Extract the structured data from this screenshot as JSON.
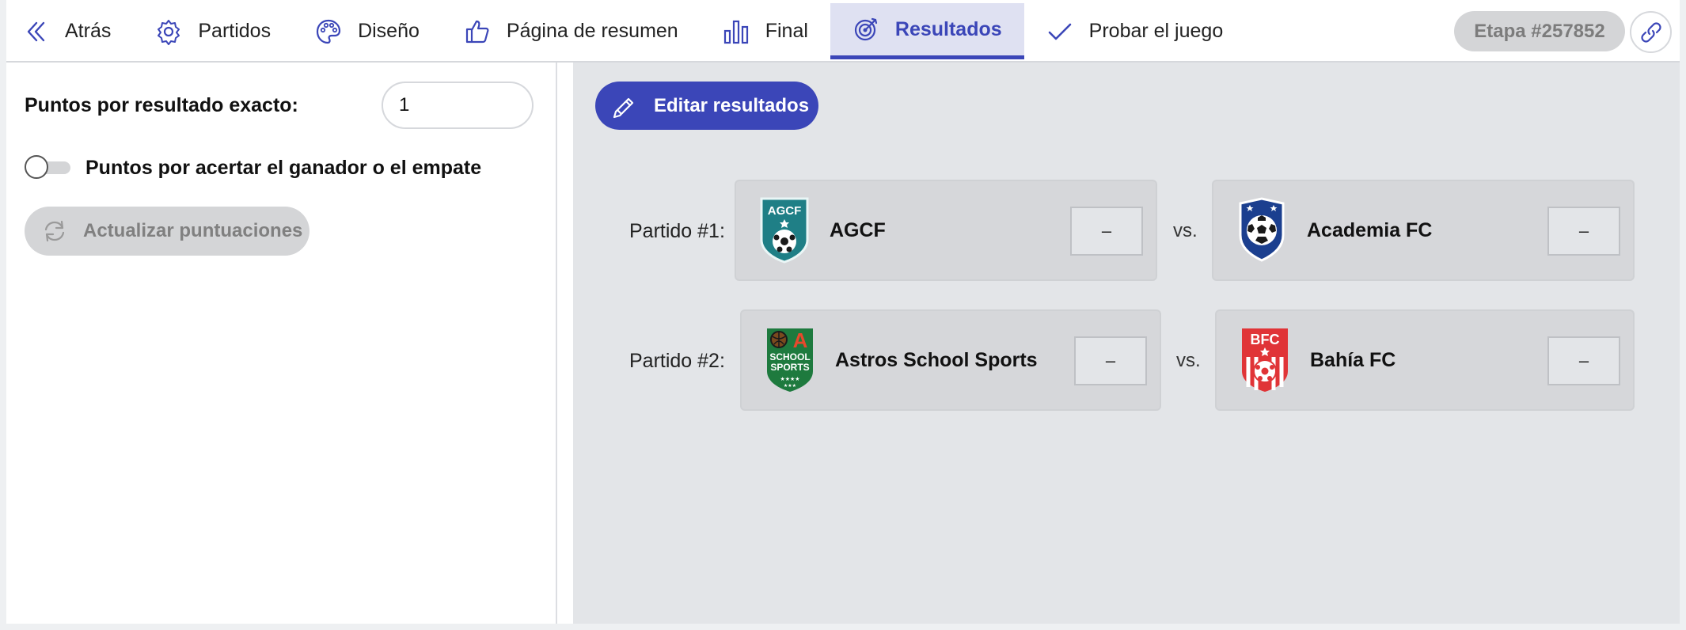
{
  "nav": {
    "tabs": [
      {
        "label": "Atrás",
        "icon": "chevron-left-icon"
      },
      {
        "label": "Partidos",
        "icon": "gear-icon"
      },
      {
        "label": "Diseño",
        "icon": "palette-icon"
      },
      {
        "label": "Página de resumen",
        "icon": "thumbs-up-icon"
      },
      {
        "label": "Final",
        "icon": "bar-chart-icon"
      },
      {
        "label": "Resultados",
        "icon": "target-icon",
        "active": true
      },
      {
        "label": "Probar el juego",
        "icon": "check-icon"
      }
    ],
    "stage_badge": "Etapa #257852",
    "link_icon": "link-icon"
  },
  "settings": {
    "exact_points_label": "Puntos por resultado exacto:",
    "exact_points_value": "1",
    "winner_toggle_label": "Puntos por acertar el ganador o el empate",
    "winner_toggle_on": false,
    "update_button": "Actualizar puntuaciones"
  },
  "results": {
    "edit_button": "Editar resultados",
    "vs_label": "vs.",
    "matches": [
      {
        "label": "Partido #1:",
        "home": {
          "name": "AGCF",
          "score": "–",
          "logo_text": "AGCF"
        },
        "away": {
          "name": "Academia FC",
          "score": "–"
        }
      },
      {
        "label": "Partido #2:",
        "home": {
          "name": "Astros School Sports",
          "score": "–",
          "logo_text": "A",
          "logo_text2": "SCHOOL",
          "logo_text3": "SPORTS"
        },
        "away": {
          "name": "Bahía FC",
          "score": "–",
          "logo_text": "BFC"
        }
      }
    ]
  },
  "colors": {
    "accent": "#3b46b8",
    "active_tab_bg": "#dfe1f2",
    "panel_bg": "#e3e5e8",
    "card_bg": "#d6d7da"
  }
}
